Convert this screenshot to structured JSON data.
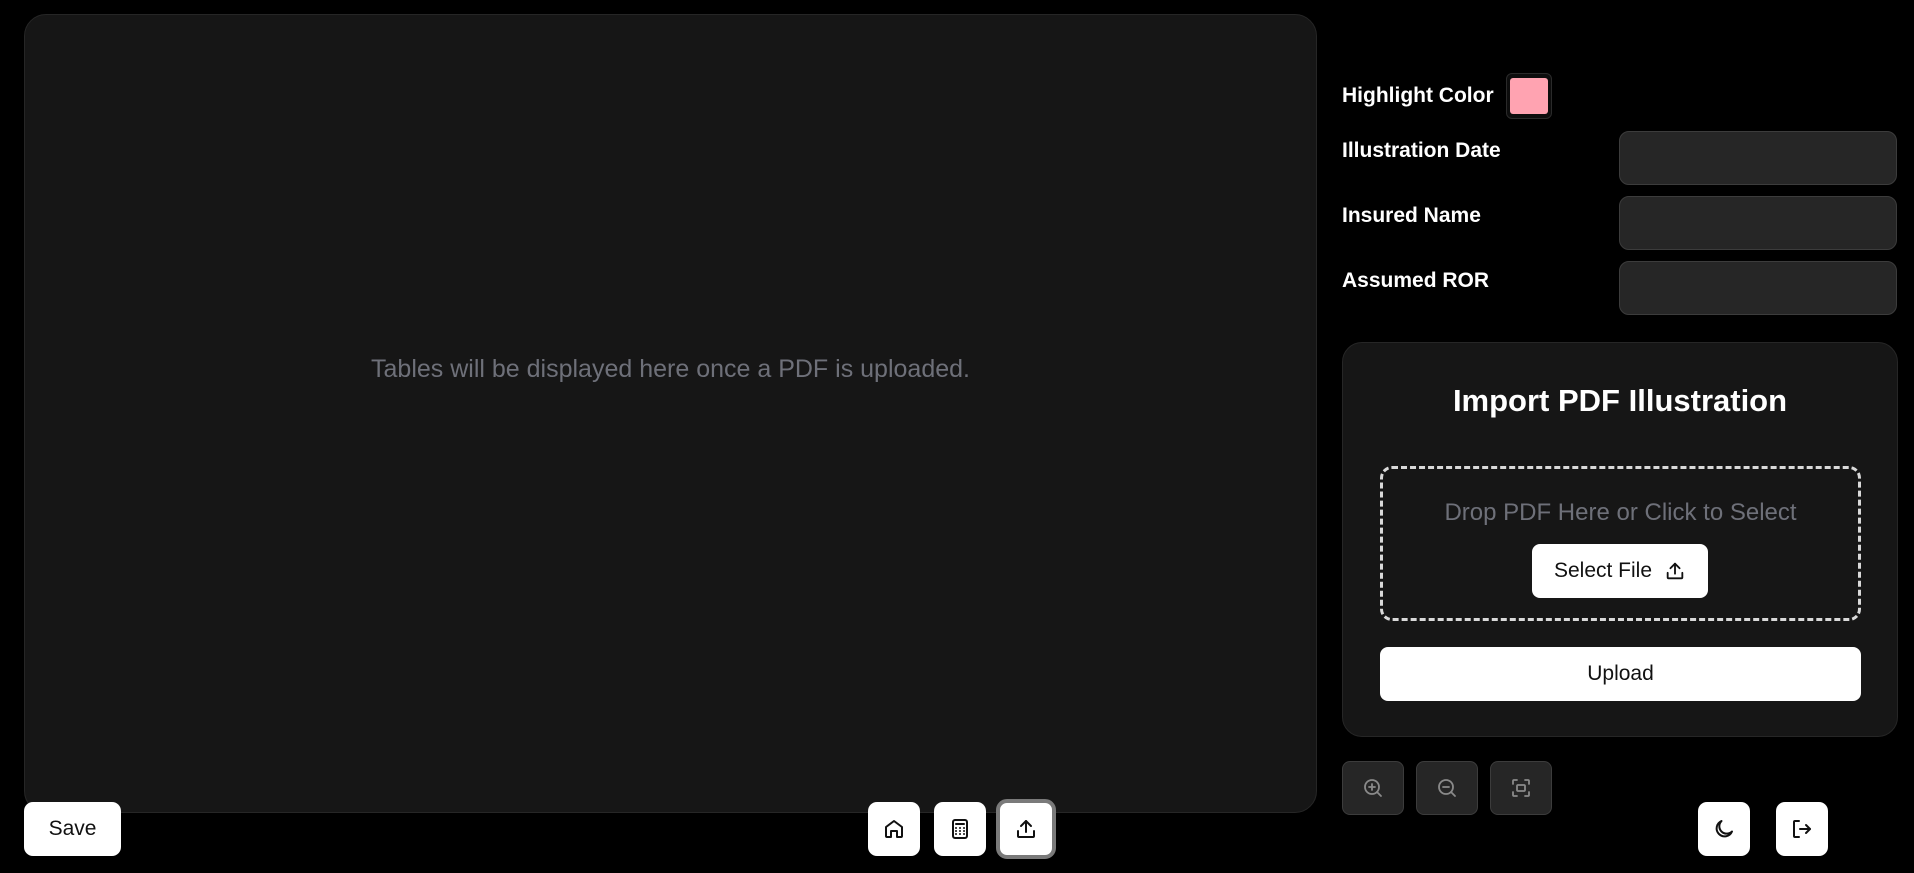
{
  "table_panel": {
    "empty_message": "Tables will be displayed here once a PDF is uploaded."
  },
  "form": {
    "highlight_color_label": "Highlight Color",
    "highlight_color_value": "#ffa3b1",
    "fields": [
      {
        "label": "Illustration Date",
        "value": ""
      },
      {
        "label": "Insured Name",
        "value": ""
      },
      {
        "label": "Assumed ROR",
        "value": ""
      }
    ]
  },
  "import": {
    "title": "Import PDF Illustration",
    "drop_text": "Drop PDF Here or Click to Select",
    "select_file_label": "Select File",
    "select_file_icon": "upload-icon",
    "upload_label": "Upload"
  },
  "zoom_controls": [
    {
      "name": "zoom-in",
      "icon": "zoom-in-icon"
    },
    {
      "name": "zoom-out",
      "icon": "zoom-out-icon"
    },
    {
      "name": "fit-screen",
      "icon": "fit-screen-icon"
    }
  ],
  "bottom_bar": {
    "save_label": "Save",
    "nav": [
      {
        "name": "home",
        "icon": "home-icon"
      },
      {
        "name": "calculator",
        "icon": "calculator-icon"
      },
      {
        "name": "upload",
        "icon": "upload-icon",
        "active": true
      }
    ],
    "theme_icon": "moon-icon",
    "logout_icon": "logout-icon"
  },
  "colors": {
    "background": "#000000",
    "panel": "#161616",
    "input": "#262626",
    "muted_text": "#6e7079",
    "accent_swatch": "#ffa3b1"
  }
}
